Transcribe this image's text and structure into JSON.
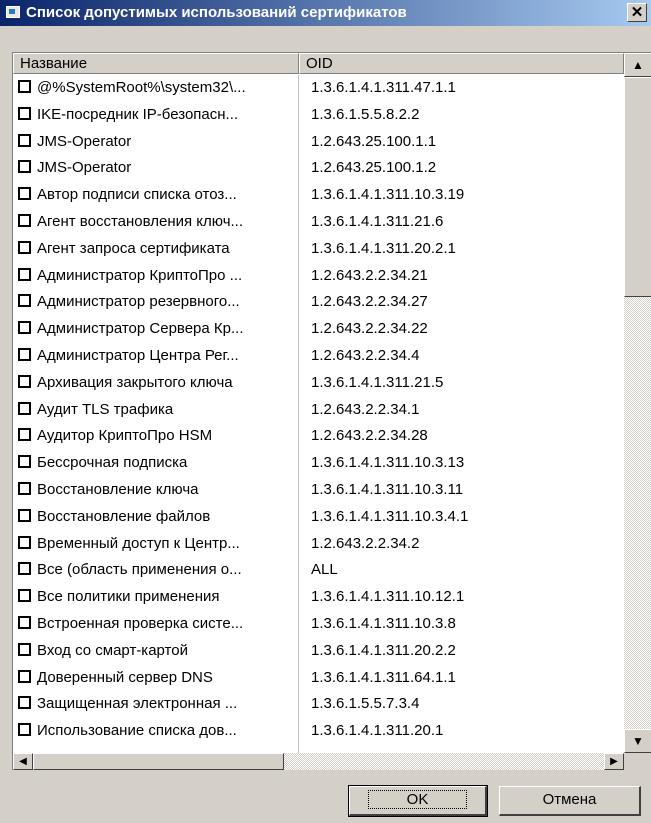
{
  "window": {
    "title": "Список допустимых использований сертификатов",
    "close_symbol": "✕"
  },
  "columns": {
    "name": "Название",
    "oid": "OID"
  },
  "rows": [
    {
      "name": "@%SystemRoot%\\system32\\...",
      "oid": "1.3.6.1.4.1.311.47.1.1"
    },
    {
      "name": "IKE-посредник IP-безопасн...",
      "oid": "1.3.6.1.5.5.8.2.2"
    },
    {
      "name": "JMS-Operator",
      "oid": "1.2.643.25.100.1.1"
    },
    {
      "name": "JMS-Operator",
      "oid": "1.2.643.25.100.1.2"
    },
    {
      "name": "Автор подписи списка отоз...",
      "oid": "1.3.6.1.4.1.311.10.3.19"
    },
    {
      "name": "Агент восстановления ключ...",
      "oid": "1.3.6.1.4.1.311.21.6"
    },
    {
      "name": "Агент запроса сертификата",
      "oid": "1.3.6.1.4.1.311.20.2.1"
    },
    {
      "name": "Администратор КриптоПро ...",
      "oid": "1.2.643.2.2.34.21"
    },
    {
      "name": "Администратор резервного...",
      "oid": "1.2.643.2.2.34.27"
    },
    {
      "name": "Администратор Сервера Кр...",
      "oid": "1.2.643.2.2.34.22"
    },
    {
      "name": "Администратор Центра Рег...",
      "oid": "1.2.643.2.2.34.4"
    },
    {
      "name": "Архивация закрытого ключа",
      "oid": "1.3.6.1.4.1.311.21.5"
    },
    {
      "name": "Аудит TLS трафика",
      "oid": "1.2.643.2.2.34.1"
    },
    {
      "name": "Аудитор КриптоПро HSM",
      "oid": "1.2.643.2.2.34.28"
    },
    {
      "name": "Бессрочная подписка",
      "oid": "1.3.6.1.4.1.311.10.3.13"
    },
    {
      "name": "Восстановление ключа",
      "oid": "1.3.6.1.4.1.311.10.3.11"
    },
    {
      "name": "Восстановление файлов",
      "oid": "1.3.6.1.4.1.311.10.3.4.1"
    },
    {
      "name": "Временный доступ к Центр...",
      "oid": "1.2.643.2.2.34.2"
    },
    {
      "name": "Все (область применения о...",
      "oid": "ALL"
    },
    {
      "name": "Все политики применения",
      "oid": "1.3.6.1.4.1.311.10.12.1"
    },
    {
      "name": "Встроенная проверка систе...",
      "oid": "1.3.6.1.4.1.311.10.3.8"
    },
    {
      "name": "Вход со смарт-картой",
      "oid": "1.3.6.1.4.1.311.20.2.2"
    },
    {
      "name": "Доверенный сервер DNS",
      "oid": "1.3.6.1.4.1.311.64.1.1"
    },
    {
      "name": "Защищенная электронная ...",
      "oid": "1.3.6.1.5.5.7.3.4"
    },
    {
      "name": "Использование списка дов...",
      "oid": "1.3.6.1.4.1.311.20.1"
    }
  ],
  "buttons": {
    "ok": "OK",
    "cancel": "Отмена"
  },
  "scroll": {
    "up": "▲",
    "down": "▼",
    "left": "◀",
    "right": "▶"
  }
}
